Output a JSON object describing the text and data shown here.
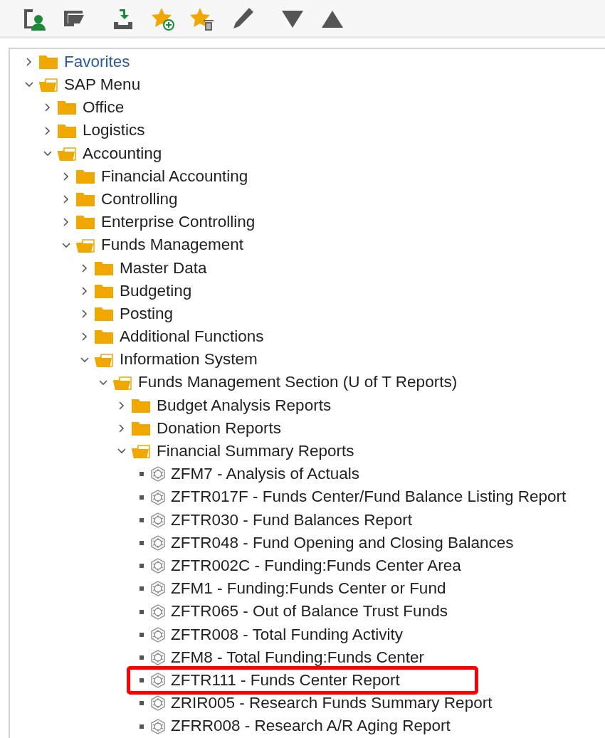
{
  "toolbar": {
    "buttons": [
      {
        "kind": "user-menu"
      },
      {
        "kind": "edit-menu"
      },
      {
        "kind": "download"
      },
      {
        "kind": "add-favorite"
      },
      {
        "kind": "delete-favorite"
      },
      {
        "kind": "pencil"
      },
      {
        "kind": "move-down"
      },
      {
        "kind": "move-up"
      }
    ]
  },
  "tree": [
    {
      "label": "Favorites",
      "kind": "favorites",
      "expanded": false
    },
    {
      "label": "SAP Menu",
      "kind": "folder",
      "expanded": true,
      "children": [
        {
          "label": "Office",
          "kind": "folder",
          "expanded": false
        },
        {
          "label": "Logistics",
          "kind": "folder",
          "expanded": false
        },
        {
          "label": "Accounting",
          "kind": "folder",
          "expanded": true,
          "children": [
            {
              "label": "Financial Accounting",
              "kind": "folder",
              "expanded": false
            },
            {
              "label": "Controlling",
              "kind": "folder",
              "expanded": false
            },
            {
              "label": "Enterprise Controlling",
              "kind": "folder",
              "expanded": false
            },
            {
              "label": "Funds Management",
              "kind": "folder",
              "expanded": true,
              "children": [
                {
                  "label": "Master Data",
                  "kind": "folder",
                  "expanded": false
                },
                {
                  "label": "Budgeting",
                  "kind": "folder",
                  "expanded": false
                },
                {
                  "label": "Posting",
                  "kind": "folder",
                  "expanded": false
                },
                {
                  "label": "Additional Functions",
                  "kind": "folder",
                  "expanded": false
                },
                {
                  "label": "Information System",
                  "kind": "folder",
                  "expanded": true,
                  "children": [
                    {
                      "label": "Funds Management Section (U of T Reports)",
                      "kind": "folder",
                      "expanded": true,
                      "children": [
                        {
                          "label": "Budget Analysis Reports",
                          "kind": "folder",
                          "expanded": false
                        },
                        {
                          "label": "Donation Reports",
                          "kind": "folder",
                          "expanded": false
                        },
                        {
                          "label": "Financial Summary Reports",
                          "kind": "folder",
                          "expanded": true,
                          "children": [
                            {
                              "label": "ZFM7 - Analysis of Actuals",
                              "kind": "transaction",
                              "highlighted": false
                            },
                            {
                              "label": "ZFTR017F - Funds Center/Fund Balance Listing Report",
                              "kind": "transaction",
                              "highlighted": false
                            },
                            {
                              "label": "ZFTR030 - Fund Balances Report",
                              "kind": "transaction",
                              "highlighted": false
                            },
                            {
                              "label": "ZFTR048 - Fund Opening and Closing Balances",
                              "kind": "transaction",
                              "highlighted": false
                            },
                            {
                              "label": "ZFTR002C - Funding:Funds Center Area",
                              "kind": "transaction",
                              "highlighted": false
                            },
                            {
                              "label": "ZFM1 - Funding:Funds Center or Fund",
                              "kind": "transaction",
                              "highlighted": false
                            },
                            {
                              "label": "ZFTR065 - Out of Balance Trust Funds",
                              "kind": "transaction",
                              "highlighted": false
                            },
                            {
                              "label": "ZFTR008 - Total Funding Activity",
                              "kind": "transaction",
                              "highlighted": false
                            },
                            {
                              "label": "ZFM8 - Total Funding:Funds Center",
                              "kind": "transaction",
                              "highlighted": false
                            },
                            {
                              "label": "ZFTR111 - Funds Center Report",
                              "kind": "transaction",
                              "highlighted": true
                            },
                            {
                              "label": "ZRIR005 - Research Funds Summary Report",
                              "kind": "transaction",
                              "highlighted": false
                            },
                            {
                              "label": "ZFRR008 - Research A/R Aging Report",
                              "kind": "transaction",
                              "highlighted": false
                            }
                          ]
                        }
                      ]
                    }
                  ]
                }
              ]
            }
          ]
        }
      ]
    }
  ]
}
